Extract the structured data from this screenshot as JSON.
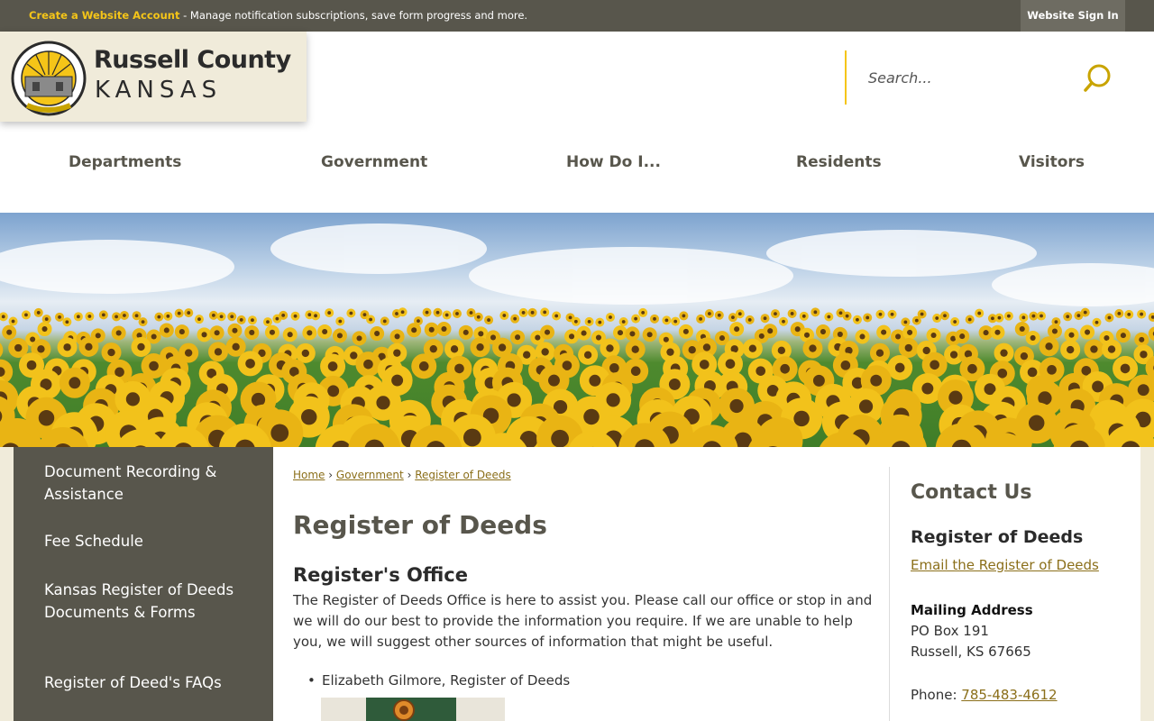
{
  "topbar": {
    "create_account_link": "Create a Website Account",
    "message": " - Manage notification subscriptions, save form progress and more.",
    "sign_in": "Website Sign In"
  },
  "logo": {
    "title": "Russell County",
    "subtitle": "KANSAS",
    "seal_icon": "county-seal-logo"
  },
  "search": {
    "placeholder": "Search...",
    "icon": "search-icon"
  },
  "nav": {
    "items": [
      "Departments",
      "Government",
      "How Do I...",
      "Residents",
      "Visitors"
    ]
  },
  "sidebar": {
    "items": [
      "Document Recording & Assistance",
      "Fee Schedule",
      "Kansas Register of Deeds Documents & Forms",
      "Register of Deed's FAQs"
    ]
  },
  "breadcrumb": {
    "items": [
      "Home",
      "Government",
      "Register of Deeds"
    ],
    "separator": "›"
  },
  "main": {
    "page_title": "Register of Deeds",
    "section_title": "Register's Office",
    "paragraph": "The Register of Deeds Office is here to assist you. Please call our office or stop in and we will do our best to provide the information you require. If we are unable to help you, we will suggest other sources of information that might be useful.",
    "bullet": "Elizabeth Gilmore, Register of Deeds"
  },
  "contact": {
    "title": "Contact Us",
    "department": "Register of Deeds",
    "email_link": "Email the Register of Deeds",
    "mailing_label": "Mailing Address",
    "address_line1": "PO Box 191",
    "address_line2": "Russell, KS 67665",
    "phone_label": "Phone: ",
    "phone": "785-483-4612"
  },
  "colors": {
    "accent": "#f5c518",
    "dark": "#58564c",
    "link": "#8b6f1a",
    "cream": "#f0ebda"
  }
}
